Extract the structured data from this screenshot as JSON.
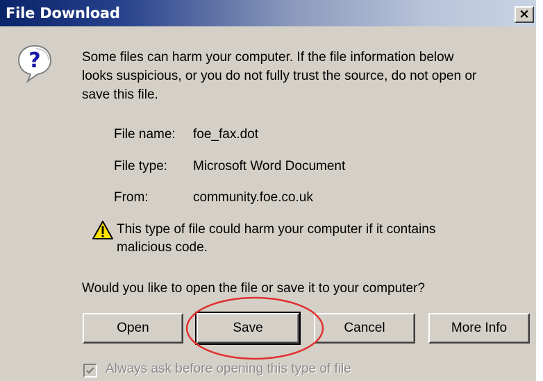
{
  "window": {
    "title": "File Download",
    "close_label": "×"
  },
  "message": {
    "line1": "Some files can harm your computer. If the file information below",
    "line2": "looks suspicious, or you do not fully trust the source, do not open or",
    "line3": "save this file."
  },
  "file_info": {
    "name_label": "File name:",
    "name_value": "foe_fax.dot",
    "type_label": "File type:",
    "type_value": "Microsoft Word Document",
    "from_label": "From:",
    "from_value": "community.foe.co.uk"
  },
  "warning": {
    "line1": "This type of file could harm your computer if it contains",
    "line2": "malicious code."
  },
  "question": "Would you like to open the file or save it to your computer?",
  "buttons": {
    "open": "Open",
    "save": "Save",
    "cancel": "Cancel",
    "more_info": "More Info"
  },
  "checkbox": {
    "label": "Always ask before opening this type of file",
    "checked": true,
    "enabled": false
  },
  "icons": {
    "question": "question-balloon-icon",
    "warning": "warning-triangle-icon"
  },
  "colors": {
    "titlebar_start": "#0a246a",
    "dialog_bg": "#d4d0c8",
    "annotation_circle": "#e03030"
  }
}
